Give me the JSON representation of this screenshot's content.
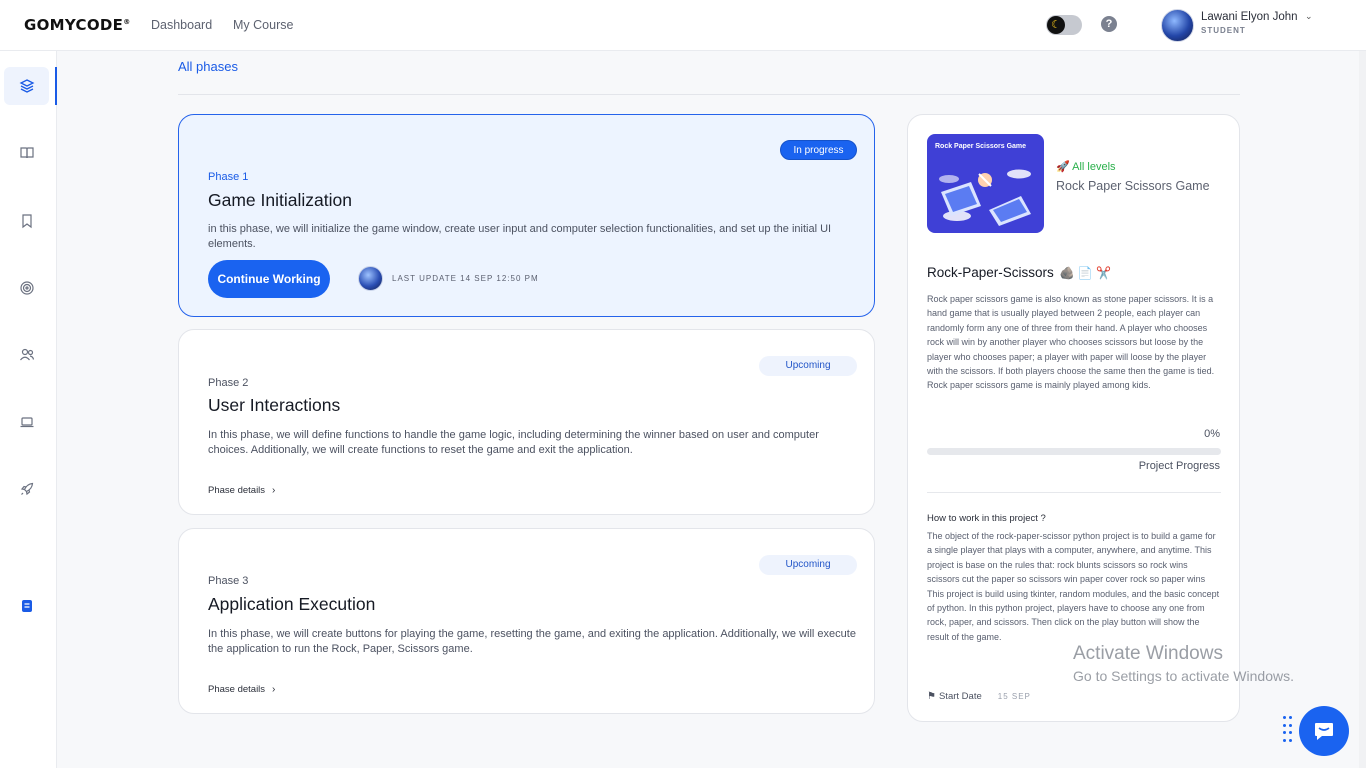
{
  "header": {
    "logo": "GOMYCODE",
    "logo_mark": "®",
    "nav": [
      "Dashboard",
      "My Course"
    ],
    "theme_toggle_icon": "moon-icon",
    "help_label": "?",
    "user": {
      "name": "Lawani Elyon John",
      "role": "STUDENT"
    }
  },
  "sidebar": {
    "items": [
      {
        "icon": "layers-icon",
        "active": true
      },
      {
        "icon": "book-icon",
        "active": false
      },
      {
        "icon": "bookmark-icon",
        "active": false
      },
      {
        "icon": "target-icon",
        "active": false
      },
      {
        "icon": "users-icon",
        "active": false
      },
      {
        "icon": "laptop-icon",
        "active": false
      },
      {
        "icon": "rocket-icon",
        "active": false
      },
      {
        "icon": "notes-icon",
        "active": false
      }
    ]
  },
  "main": {
    "all_phases_link": "All phases",
    "phases": [
      {
        "label": "Phase 1",
        "title": "Game Initialization",
        "description": "in this phase, we will initialize the game window, create user input and computer selection functionalities, and set up the initial UI elements.",
        "status": "In progress",
        "action": "Continue Working",
        "last_update": "LAST UPDATE 14 SEP 12:50 PM"
      },
      {
        "label": "Phase 2",
        "title": "User Interactions",
        "description": "In this phase, we will define functions to handle the game logic, including determining the winner based on user and computer choices. Additionally, we will create functions to reset the game and exit the application.",
        "status": "Upcoming",
        "details_link": "Phase details"
      },
      {
        "label": "Phase 3",
        "title": "Application Execution",
        "description": "In this phase, we will create buttons for playing the game, resetting the game, and exiting the application. Additionally, we will execute the application to run the Rock, Paper, Scissors game.",
        "status": "Upcoming",
        "details_link": "Phase details"
      }
    ]
  },
  "project": {
    "thumbnail_title": "Rock Paper Scissors Game",
    "level": "All levels",
    "name": "Rock Paper Scissors Game",
    "heading": "Rock-Paper-Scissors",
    "heading_emoji": "🪨 📄 ✂️",
    "description": "Rock paper scissors game is also known as stone paper scissors. It is a hand game that is usually played between 2 people, each player can randomly form any one of three from their hand. A player who chooses rock will win by another player who chooses scissors but loose by the player who chooses paper; a player with paper will loose by the player with the scissors. If both players choose the same then the game is tied. Rock paper scissors game is mainly played among kids.",
    "progress_text": "0%",
    "progress_value": 0,
    "progress_label": "Project Progress",
    "how_title": "How to work in this project ?",
    "how_text": "The object of the rock-paper-scissor python project is to build a game for a single player that plays with a computer, anywhere, and anytime. This project is base on the rules that: rock blunts scissors so rock wins scissors cut the paper so scissors win paper cover rock so paper wins This project is build using tkinter, random modules, and the basic concept of python. In this python project, players have to choose any one from rock, paper, and scissors. Then click on the play button will show the result of the game.",
    "start_date_label": "Start Date",
    "start_date": "15 SEP"
  },
  "overlay": {
    "activate_title": "Activate Windows",
    "activate_sub": "Go to Settings to activate Windows."
  },
  "colors": {
    "accent": "#1a63f0",
    "success": "#2ab04b",
    "active_card_bg": "#edf4ff"
  }
}
